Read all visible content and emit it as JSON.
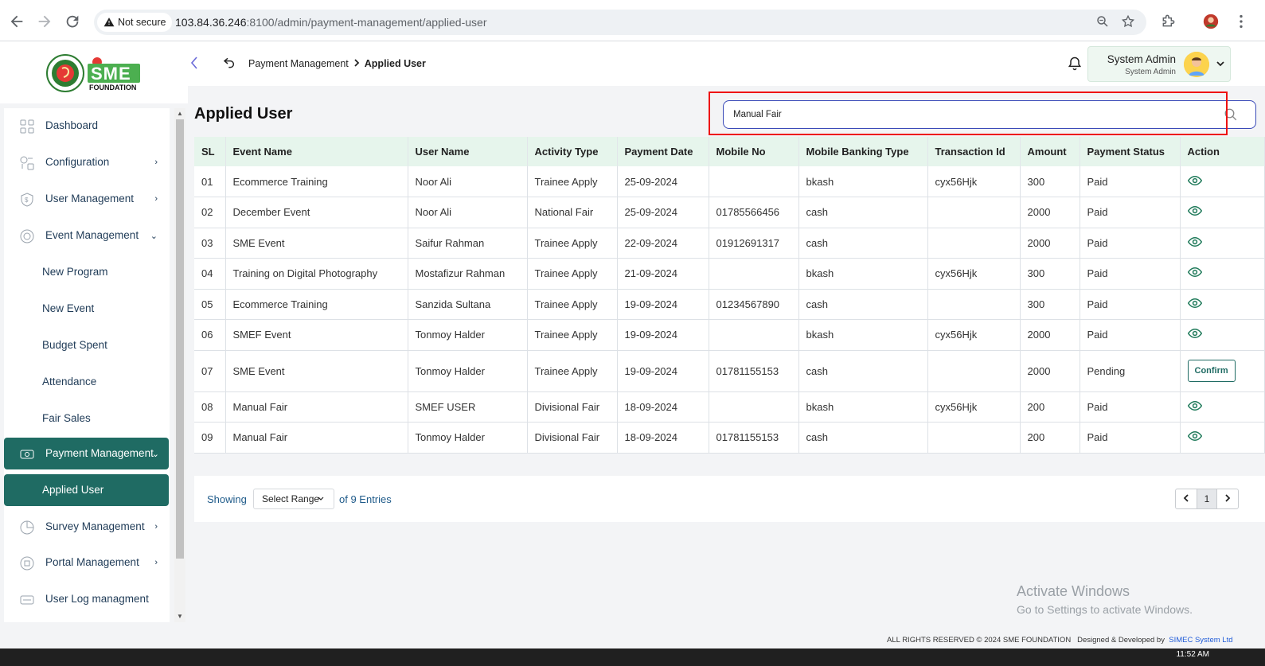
{
  "browser": {
    "security_label": "Not secure",
    "url_host": "103.84.36.246",
    "url_rest": ":8100/admin/payment-management/applied-user"
  },
  "header": {
    "logo_text": "SME",
    "logo_sub": "FOUNDATION",
    "breadcrumb_parent": "Payment Management",
    "breadcrumb_current": "Applied User",
    "user_name": "System Admin",
    "user_role": "System Admin"
  },
  "sidebar": {
    "items": [
      {
        "label": "Dashboard"
      },
      {
        "label": "Configuration"
      },
      {
        "label": "User Management"
      },
      {
        "label": "Event Management"
      },
      {
        "label": "New Program"
      },
      {
        "label": "New Event"
      },
      {
        "label": "Budget Spent"
      },
      {
        "label": "Attendance"
      },
      {
        "label": "Fair Sales"
      },
      {
        "label": "Payment Management"
      },
      {
        "label": "Applied User"
      },
      {
        "label": "Survey Management"
      },
      {
        "label": "Portal Management"
      },
      {
        "label": "User Log managment"
      }
    ]
  },
  "main": {
    "title": "Applied User",
    "search_value": "Manual Fair",
    "columns": [
      "SL",
      "Event Name",
      "User Name",
      "Activity Type",
      "Payment Date",
      "Mobile No",
      "Mobile Banking Type",
      "Transaction Id",
      "Amount",
      "Payment Status",
      "Action"
    ],
    "rows": [
      {
        "sl": "01",
        "event": "Ecommerce Training",
        "user": "Noor Ali",
        "activity": "Trainee Apply",
        "date": "25-09-2024",
        "mobile": "",
        "banking": "bkash",
        "txn": "cyx56Hjk",
        "amount": "300",
        "status": "Paid",
        "action": "view"
      },
      {
        "sl": "02",
        "event": "December Event",
        "user": "Noor Ali",
        "activity": "National Fair",
        "date": "25-09-2024",
        "mobile": "01785566456",
        "banking": "cash",
        "txn": "",
        "amount": "2000",
        "status": "Paid",
        "action": "view"
      },
      {
        "sl": "03",
        "event": "SME Event",
        "user": "Saifur Rahman",
        "activity": "Trainee Apply",
        "date": "22-09-2024",
        "mobile": "01912691317",
        "banking": "cash",
        "txn": "",
        "amount": "2000",
        "status": "Paid",
        "action": "view"
      },
      {
        "sl": "04",
        "event": "Training on Digital Photography",
        "user": "Mostafizur Rahman",
        "activity": "Trainee Apply",
        "date": "21-09-2024",
        "mobile": "",
        "banking": "bkash",
        "txn": "cyx56Hjk",
        "amount": "300",
        "status": "Paid",
        "action": "view"
      },
      {
        "sl": "05",
        "event": "Ecommerce Training",
        "user": "Sanzida Sultana",
        "activity": "Trainee Apply",
        "date": "19-09-2024",
        "mobile": "01234567890",
        "banking": "cash",
        "txn": "",
        "amount": "300",
        "status": "Paid",
        "action": "view"
      },
      {
        "sl": "06",
        "event": "SMEF Event",
        "user": "Tonmoy Halder",
        "activity": "Trainee Apply",
        "date": "19-09-2024",
        "mobile": "",
        "banking": "bkash",
        "txn": "cyx56Hjk",
        "amount": "2000",
        "status": "Paid",
        "action": "view"
      },
      {
        "sl": "07",
        "event": "SME Event",
        "user": "Tonmoy Halder",
        "activity": "Trainee Apply",
        "date": "19-09-2024",
        "mobile": "01781155153",
        "banking": "cash",
        "txn": "",
        "amount": "2000",
        "status": "Pending",
        "action": "confirm"
      },
      {
        "sl": "08",
        "event": "Manual Fair",
        "user": "SMEF USER",
        "activity": "Divisional Fair",
        "date": "18-09-2024",
        "mobile": "",
        "banking": "bkash",
        "txn": "cyx56Hjk",
        "amount": "200",
        "status": "Paid",
        "action": "view"
      },
      {
        "sl": "09",
        "event": "Manual Fair",
        "user": "Tonmoy Halder",
        "activity": "Divisional Fair",
        "date": "18-09-2024",
        "mobile": "01781155153",
        "banking": "cash",
        "txn": "",
        "amount": "200",
        "status": "Paid",
        "action": "view"
      }
    ],
    "confirm_label": "Confirm",
    "pagination": {
      "showing_label": "Showing",
      "range_select": "Select Range",
      "entries_label": "of 9 Entries",
      "current_page": "1"
    }
  },
  "footer": {
    "activate_title": "Activate Windows",
    "activate_sub": "Go to Settings to activate Windows.",
    "copyright": "ALL RIGHTS RESERVED © 2024 SME FOUNDATION",
    "designed_by": "Designed & Developed by",
    "developer": "SIMEC System Ltd",
    "clock": "11:52 AM"
  },
  "colors": {
    "primary": "#1f6b63",
    "header_row": "#e6f5ec",
    "highlight_border": "#e11111"
  }
}
